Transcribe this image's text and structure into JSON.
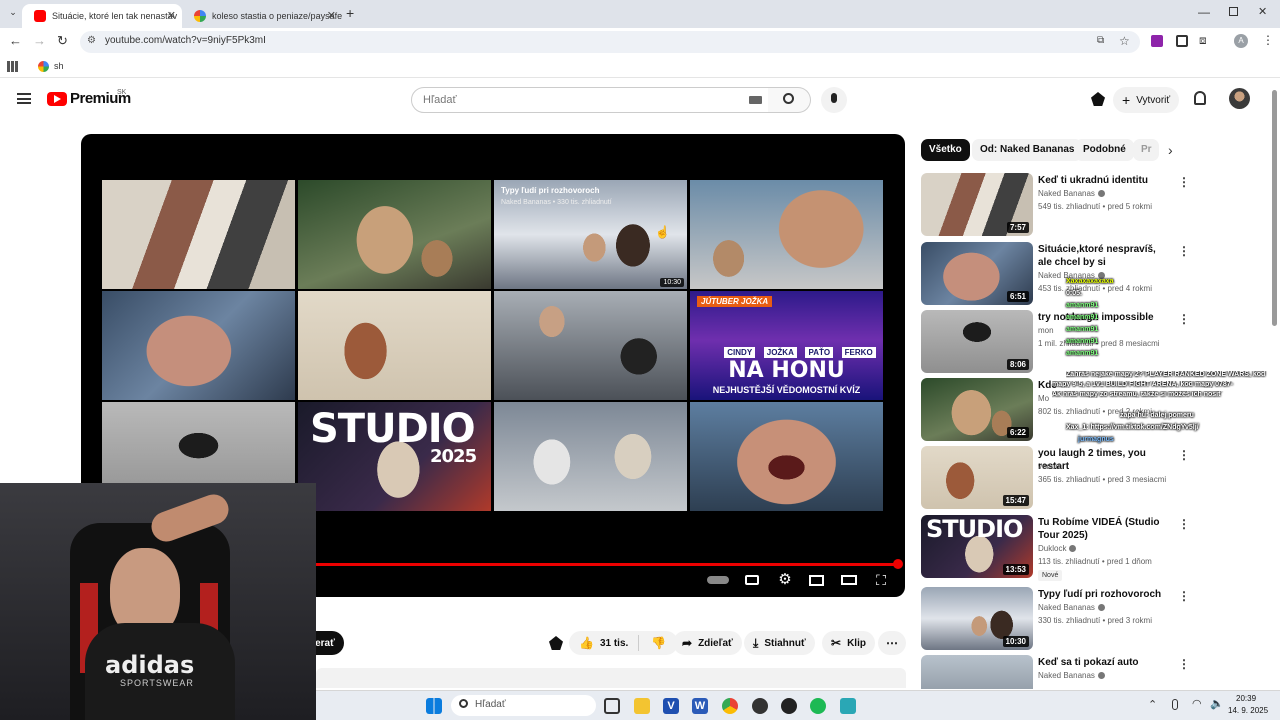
{
  "browser": {
    "tabs": [
      {
        "title": "Situácie, ktoré len tak nenastáv",
        "active": true
      },
      {
        "title": "koleso stastia o peniaze/paysafe",
        "active": false
      }
    ],
    "url": "youtube.com/watch?v=9niyF5Pk3mI",
    "bookmark": "sh",
    "profile_initial": "A"
  },
  "youtube": {
    "logo_text": "Premium",
    "region": "SK",
    "search_placeholder": "Hľadať",
    "create_label": "Vytvoriť"
  },
  "player": {
    "end_grid": [
      {
        "title": "",
        "sub": "",
        "duration": ""
      },
      {
        "title": "",
        "sub": "",
        "duration": ""
      },
      {
        "title": "Typy ľudí pri rozhovoroch",
        "sub": "Naked Bananas • 330 tis. zhliadnutí",
        "duration": "10:30"
      },
      {
        "title": "",
        "sub": "",
        "duration": ""
      },
      {
        "title": "",
        "sub": "",
        "duration": ""
      },
      {
        "title": "",
        "sub": "",
        "duration": ""
      },
      {
        "title": "",
        "sub": "",
        "duration": ""
      },
      {
        "title": "JÚTUBER JOŽKA",
        "sub": "",
        "duration": ""
      },
      {
        "title": "",
        "sub": "",
        "duration": ""
      },
      {
        "title": "STUDIO",
        "sub": "2025",
        "duration": ""
      },
      {
        "title": "",
        "sub": "",
        "duration": ""
      },
      {
        "title": "",
        "sub": "",
        "duration": ""
      }
    ],
    "na_honu": {
      "names": [
        "CINDY",
        "JOŽKA",
        "PAŤO",
        "FERKO"
      ],
      "headline": "NA HONU",
      "tagline": "NEJHUSTĚJŠÍ VĚDOMOSTNÍ KVÍZ"
    },
    "progress": 0.99
  },
  "actions": {
    "subscribe_partial": "berať",
    "likes": "31 tis.",
    "share": "Zdieľať",
    "download": "Stiahnuť",
    "clip": "Klip"
  },
  "chips": [
    "Všetko",
    "Od: Naked Bananas",
    "Podobné",
    "Pr"
  ],
  "related": [
    {
      "title": "Keď ti ukradnú identitu",
      "channel": "Naked Bananas",
      "verified": true,
      "meta": "549 tis. zhliadnutí • pred 5 rokmi",
      "duration": "7:57",
      "badge": ""
    },
    {
      "title": "Situácie,ktoré nespravíš, ale chcel by si",
      "channel": "Naked Bananas",
      "verified": true,
      "meta": "453 tis. zhliadnutí • pred 4 rokmi",
      "duration": "6:51",
      "badge": ""
    },
    {
      "title": "try not laugh impossible",
      "channel": "mon",
      "verified": false,
      "meta": "1 mil. zhliadnutí • pred 8 mesiacmi",
      "duration": "8:06",
      "badge": ""
    },
    {
      "title": "Kde",
      "channel": "Mo",
      "verified": false,
      "meta": "802 tis. zhliadnutí • pred 2 rokmi",
      "duration": "6:22",
      "badge": ""
    },
    {
      "title": "you laugh 2 times, you restart",
      "channel": "venom",
      "verified": false,
      "meta": "365 tis. zhliadnutí • pred 3 mesiacmi",
      "duration": "15:47",
      "badge": ""
    },
    {
      "title": "Tu Robíme VIDEÁ (Studio Tour 2025)",
      "channel": "Duklock",
      "verified": true,
      "meta": "113 tis. zhliadnutí • pred 1 dňom",
      "duration": "13:53",
      "badge": "Nové"
    },
    {
      "title": "Typy ľudí pri rozhovoroch",
      "channel": "Naked Bananas",
      "verified": true,
      "meta": "330 tis. zhliadnutí • pred 3 rokmi",
      "duration": "10:30",
      "badge": ""
    },
    {
      "title": "Keď sa ti pokazí auto",
      "channel": "Naked Bananas",
      "verified": true,
      "meta": "",
      "duration": "",
      "badge": ""
    }
  ],
  "chat": [
    "Xaxaxaxaxaxa",
    "0:05.",
    "amanm91",
    "amanm91",
    "amanm91",
    "amanm91",
    "amanm91",
    "Zahráš nejaké mapy 2? PLAYER RANKED ZONE WARS, kod",
    "mapy 9-5, a 1v1 BUILD FIGHT ARENA, kod mapy 0787-",
    "Ak hráš mapy zo streamu, takže si môžeš ich nosiť",
    "zapa hu: dalej pomeru",
    "Xax_1: https://vm.tiktok.com/ZNdgYv5lj/",
    "jurmagnus"
  ],
  "webcam": {
    "shirt_text_1": "adidas",
    "shirt_text_2": "SPORTSWEAR"
  },
  "taskbar": {
    "search_placeholder": "Hľadať",
    "time": "20:39",
    "date": "14. 9. 2025"
  }
}
